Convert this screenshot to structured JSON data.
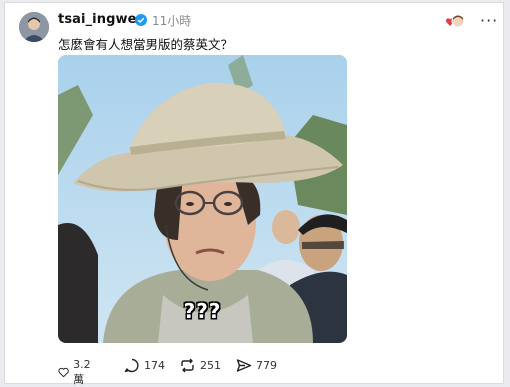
{
  "post": {
    "username": "tsai_ingwen",
    "time": "11小時",
    "text": "怎麼會有人想當男版的蔡英文？",
    "media_caption": "???",
    "more": "···"
  },
  "actions": {
    "likes": "3.2 萬",
    "comments": "174",
    "reposts": "251",
    "shares": "779"
  },
  "colors": {
    "verified": "#1d9bf0",
    "heart_reaction": "#e53945"
  }
}
